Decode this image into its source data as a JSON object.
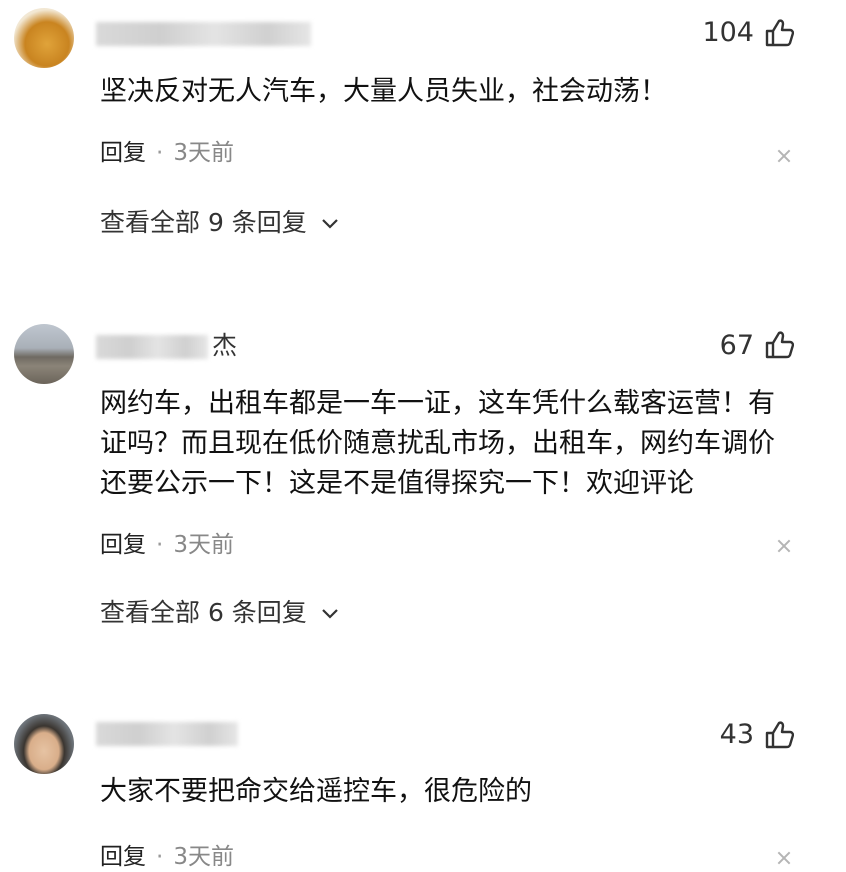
{
  "comments": [
    {
      "username_tail": "",
      "likes": "104",
      "text": "坚决反对无人汽车，大量人员失业，社会动荡！",
      "reply_label": "回复",
      "separator": "·",
      "time": "3天前",
      "view_replies": "查看全部 9 条回复"
    },
    {
      "username_tail": "杰",
      "likes": "67",
      "text_lines": [
        "网约车，出租车都是一车一证，这车凭什么载客运营！有",
        "证吗？而且现在低价随意扰乱市场，出租车，网约车调价",
        "还要公示一下！这是不是值得探究一下！欢迎评论"
      ],
      "reply_label": "回复",
      "separator": "·",
      "time": "3天前",
      "view_replies": "查看全部 6 条回复"
    },
    {
      "username_tail": "",
      "likes": "43",
      "text": "大家不要把命交给遥控车，很危险的",
      "reply_label": "回复",
      "separator": "·",
      "time": "3天前"
    }
  ],
  "icons": {
    "like": "thumbs-up-icon",
    "close": "close-icon",
    "chevron": "chevron-down-icon"
  }
}
